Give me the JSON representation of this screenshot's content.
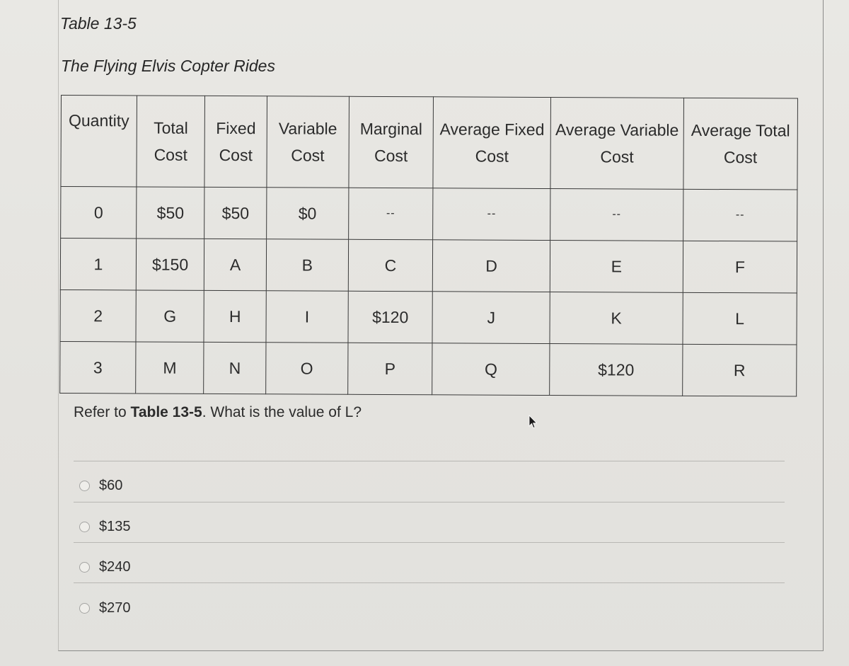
{
  "table_label": "Table 13-5",
  "table_title": "The Flying Elvis Copter Rides",
  "table": {
    "headers": [
      [
        "Quantity",
        ""
      ],
      [
        "Total",
        "Cost"
      ],
      [
        "Fixed",
        "Cost"
      ],
      [
        "Variable",
        "Cost"
      ],
      [
        "Marginal",
        "Cost"
      ],
      [
        "Average Fixed",
        "Cost"
      ],
      [
        "Average Variable",
        "Cost"
      ],
      [
        "Average Total",
        "Cost"
      ]
    ],
    "rows": [
      [
        "0",
        "$50",
        "$50",
        "$0",
        "--",
        "--",
        "--",
        "--"
      ],
      [
        "1",
        "$150",
        "A",
        "B",
        "C",
        "D",
        "E",
        "F"
      ],
      [
        "2",
        "G",
        "H",
        "I",
        "$120",
        "J",
        "K",
        "L"
      ],
      [
        "3",
        "M",
        "N",
        "O",
        "P",
        "Q",
        "$120",
        "R"
      ]
    ]
  },
  "question": {
    "prefix": "Refer to ",
    "reference": "Table 13-5",
    "suffix": ". What is the value of L?"
  },
  "options": [
    {
      "label": "$60",
      "selected": false
    },
    {
      "label": "$135",
      "selected": false
    },
    {
      "label": "$240",
      "selected": false
    },
    {
      "label": "$270",
      "selected": false
    }
  ]
}
